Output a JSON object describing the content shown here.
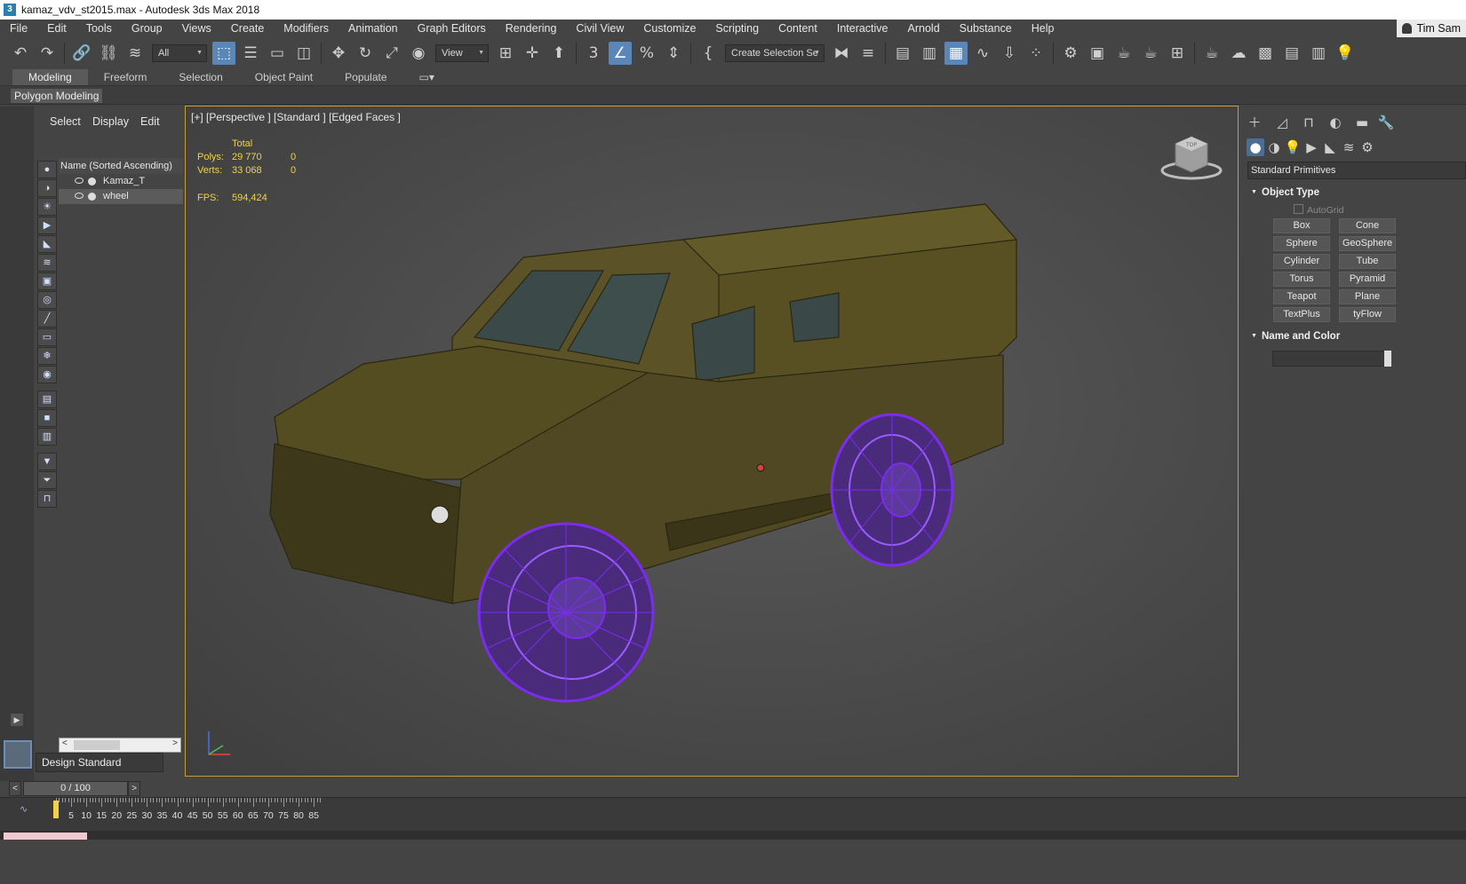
{
  "window": {
    "title": "kamaz_vdv_st2015.max - Autodesk 3ds Max 2018"
  },
  "menu": {
    "items": [
      "File",
      "Edit",
      "Tools",
      "Group",
      "Views",
      "Create",
      "Modifiers",
      "Animation",
      "Graph Editors",
      "Rendering",
      "Civil View",
      "Customize",
      "Scripting",
      "Content",
      "Interactive",
      "Arnold",
      "Substance",
      "Help"
    ],
    "user": "Tim Sam"
  },
  "toolbar": {
    "selection_filter": "All",
    "ref_coord": "View",
    "named_selection": "Create Selection Se"
  },
  "ribbon": {
    "tabs": [
      "Modeling",
      "Freeform",
      "Selection",
      "Object Paint",
      "Populate"
    ],
    "active_tab": "Modeling",
    "panel_label": "Polygon Modeling"
  },
  "scene_explorer": {
    "tabs": [
      "Select",
      "Display",
      "Edit"
    ],
    "column_header": "Name (Sorted Ascending)",
    "rows": [
      {
        "name": "Kamaz_T",
        "selected": false
      },
      {
        "name": "wheel",
        "selected": true
      }
    ]
  },
  "workspace": {
    "label": "Design Standard"
  },
  "viewport": {
    "label": "[+] [Perspective ] [Standard ] [Edged Faces ]",
    "stats": {
      "total_label": "Total",
      "polys_label": "Polys:",
      "polys_total": "29 770",
      "polys_sel": "0",
      "verts_label": "Verts:",
      "verts_total": "33 068",
      "verts_sel": "0",
      "fps_label": "FPS:",
      "fps_value": "594,424"
    },
    "viewcube_face": "TOP"
  },
  "command_panel": {
    "category": "Standard Primitives",
    "object_type_title": "Object Type",
    "autogrid_label": "AutoGrid",
    "buttons": [
      "Box",
      "Cone",
      "Sphere",
      "GeoSphere",
      "Cylinder",
      "Tube",
      "Torus",
      "Pyramid",
      "Teapot",
      "Plane",
      "TextPlus",
      "tyFlow"
    ],
    "name_color_title": "Name and Color"
  },
  "time": {
    "slider_label": "0 / 100",
    "prev": "<",
    "next": ">",
    "ticks": [
      "0",
      "5",
      "10",
      "15",
      "20",
      "25",
      "30",
      "35",
      "40",
      "45",
      "50",
      "55",
      "60",
      "65",
      "70",
      "75",
      "80",
      "85"
    ],
    "current_frame": 0
  },
  "colors": {
    "viewport_border": "#c89b3a",
    "stats_text": "#f2d247",
    "wheel_wire": "#7b2cf0",
    "vehicle_body": "#5b5327",
    "active_blue": "#5b86b8"
  }
}
